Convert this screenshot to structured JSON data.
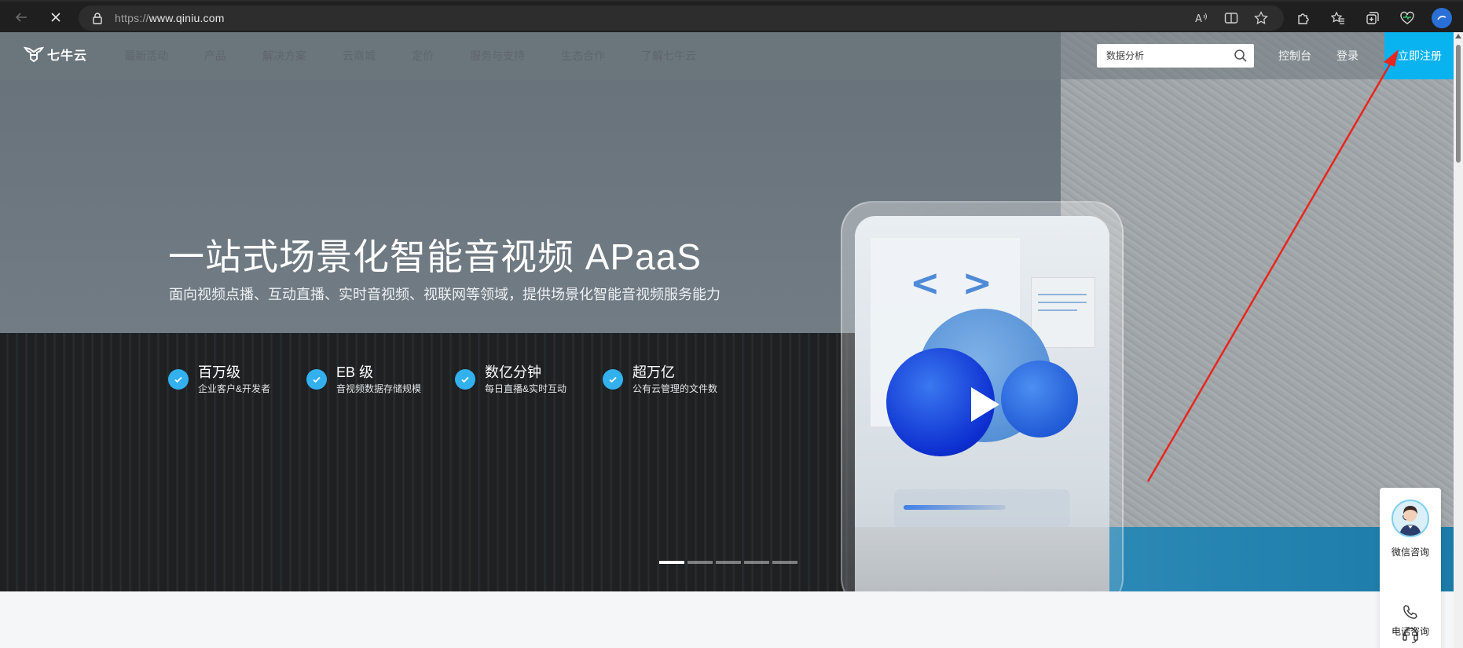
{
  "browser": {
    "url_protocol": "https://",
    "url_host": "www.qiniu.com"
  },
  "header": {
    "logo_text": "七牛云",
    "nav": [
      "最新活动",
      "产品",
      "解决方案",
      "云商城",
      "定价",
      "服务与支持",
      "生态合作",
      "了解七牛云"
    ],
    "search_placeholder": "数据分析",
    "console_label": "控制台",
    "login_label": "登录",
    "register_label": "立即注册"
  },
  "hero": {
    "title": "一站式场景化智能音视频 APaaS",
    "subtitle": "面向视频点播、互动直播、实时音视频、视联网等领域，提供场景化智能音视频服务能力",
    "features": [
      {
        "title": "百万级",
        "desc": "企业客户&开发者"
      },
      {
        "title": "EB 级",
        "desc": "音视频数据存储规模"
      },
      {
        "title": "数亿分钟",
        "desc": "每日直播&实时互动"
      },
      {
        "title": "超万亿",
        "desc": "公有云管理的文件数"
      }
    ],
    "carousel_count": 5,
    "carousel_active": 1
  },
  "consult": {
    "wechat_label": "微信咨询",
    "phone_label": "电话咨询"
  },
  "colors": {
    "accent": "#08b3f0",
    "check": "#32b1ee",
    "annotation": "#e8261e"
  }
}
